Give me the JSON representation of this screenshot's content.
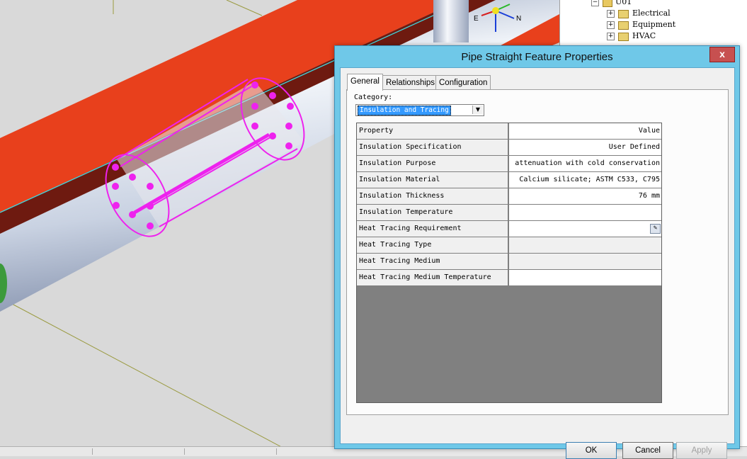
{
  "tree": {
    "root_label": "U01",
    "items": [
      {
        "label": "Electrical",
        "icon": "electrical-folder-icon"
      },
      {
        "label": "Equipment",
        "icon": "equipment-folder-icon"
      },
      {
        "label": "HVAC",
        "icon": "hvac-folder-icon"
      }
    ]
  },
  "compass": {
    "north_label": "N",
    "east_label": "E"
  },
  "dialog": {
    "title": "Pipe Straight Feature Properties",
    "close_label": "x",
    "tabs": [
      {
        "label": "General",
        "active": true
      },
      {
        "label": "Relationships",
        "active": false
      },
      {
        "label": "Configuration",
        "active": false
      }
    ],
    "category": {
      "label": "Category:",
      "value": "Insulation and Tracing"
    },
    "grid": {
      "header": {
        "property": "Property",
        "value": "Value"
      },
      "rows": [
        {
          "property": "Insulation Specification",
          "value": "User Defined"
        },
        {
          "property": "Insulation Purpose",
          "value": "attenuation with cold conservation"
        },
        {
          "property": "Insulation Material",
          "value": "Calcium silicate; ASTM C533, C795"
        },
        {
          "property": "Insulation Thickness",
          "value": "76 mm"
        },
        {
          "property": "Insulation Temperature",
          "value": ""
        },
        {
          "property": "Heat Tracing Requirement",
          "value": ""
        },
        {
          "property": "Heat Tracing Type",
          "value": ""
        },
        {
          "property": "Heat Tracing Medium",
          "value": ""
        },
        {
          "property": "Heat Tracing Medium Temperature",
          "value": ""
        }
      ]
    },
    "buttons": {
      "ok": "OK",
      "cancel": "Cancel",
      "apply": "Apply"
    }
  },
  "colors": {
    "titlebar": "#6fc8e8",
    "close_button": "#c75050",
    "selection": "#3399ff",
    "highlight_magenta": "#ee22ee",
    "beam_red": "#e8401c"
  }
}
